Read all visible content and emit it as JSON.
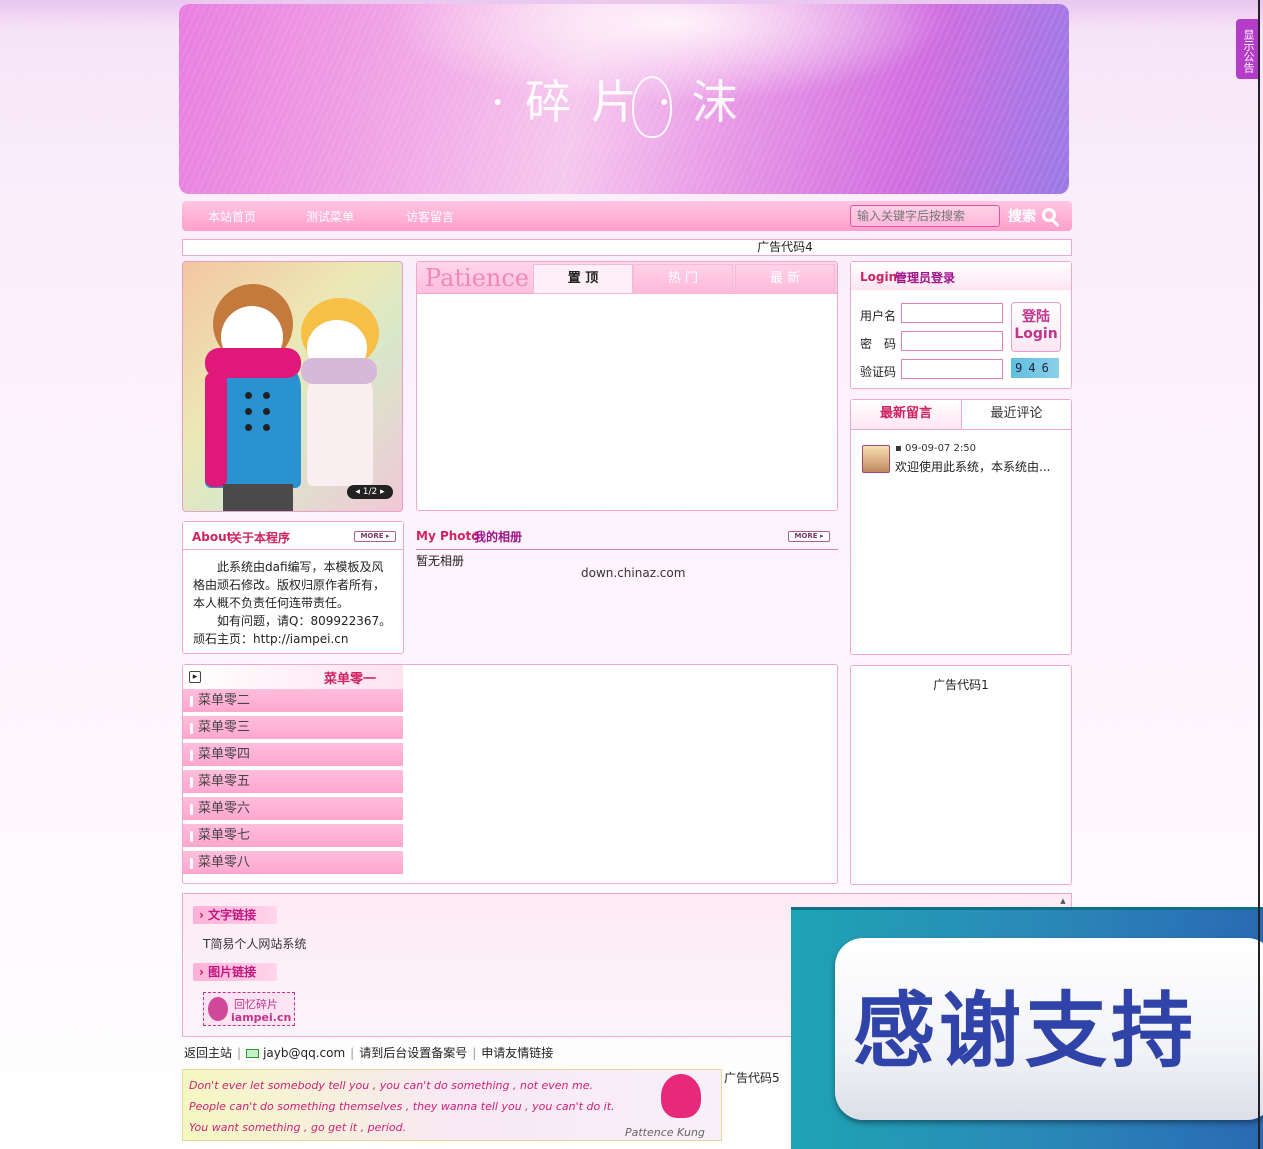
{
  "notice_tab": "显示公告",
  "banner": {
    "title": "·碎片·沫"
  },
  "nav": {
    "items": [
      "本站首页",
      "测试菜单",
      "访客留言"
    ],
    "search_placeholder": "输入关键字后按搜索",
    "search_label": "搜索"
  },
  "ads": {
    "ad4": "广告代码4",
    "ad1": "广告代码1",
    "ad5": "广告代码5"
  },
  "slideshow": {
    "counter": "1/2"
  },
  "tabs": {
    "logo": "Patience",
    "items": [
      "置 顶",
      "热 门",
      "最 新"
    ],
    "active": "置 顶"
  },
  "login": {
    "title_en": "Login",
    "title_cn": "管理员登录",
    "username_label": "用户名",
    "password_label": "密　码",
    "captcha_label": "验证码",
    "button_line1": "登陆",
    "button_line2": "Login",
    "captcha_value": "946"
  },
  "messages": {
    "tab_new": "最新留言",
    "tab_comments": "最近评论",
    "items": [
      {
        "time": "09-09-07 2:50",
        "text": "欢迎使用此系统，本系统由..."
      }
    ]
  },
  "about": {
    "title_en": "About",
    "title_cn": "关于本程序",
    "more": "MORE",
    "line1": "此系统由dafi编写，本模板及风格由顽石修改。版权归原作者所有，本人概不负责任何连带责任。",
    "line2": "如有问题，请Q：809922367。",
    "line3": "顽石主页：http://iampei.cn"
  },
  "photo": {
    "title_en": "My Photo",
    "title_cn": "我的相册",
    "more": "MORE",
    "empty": "暂无相册",
    "watermark": "down.chinaz.com"
  },
  "menu": {
    "head": "菜单零一",
    "items": [
      "菜单零二",
      "菜单零三",
      "菜单零四",
      "菜单零五",
      "菜单零六",
      "菜单零七",
      "菜单零八"
    ]
  },
  "links": {
    "text_head": "文字链接",
    "text_item": "T简易个人网站系统",
    "pic_head": "图片链接",
    "pic_cn": "回忆碎片",
    "pic_en": "iampei.cn"
  },
  "footer": {
    "home": "返回主站",
    "email": "jayb@qq.com",
    "icp": "请到后台设置备案号",
    "apply_link": "申请友情链接"
  },
  "quote": {
    "line1": "Don't ever let somebody tell you , you can't do something , not even me.",
    "line2": "People can't do something themselves , they wanna tell you , you can't do it.",
    "line3": "You want something , go get it , period.",
    "signature": "Pattence Kung"
  },
  "popup": {
    "text": "感谢支持"
  },
  "colors": {
    "accent": "#d02460",
    "pink": "#ffa6cf",
    "popup_blue": "#2f43a8"
  }
}
